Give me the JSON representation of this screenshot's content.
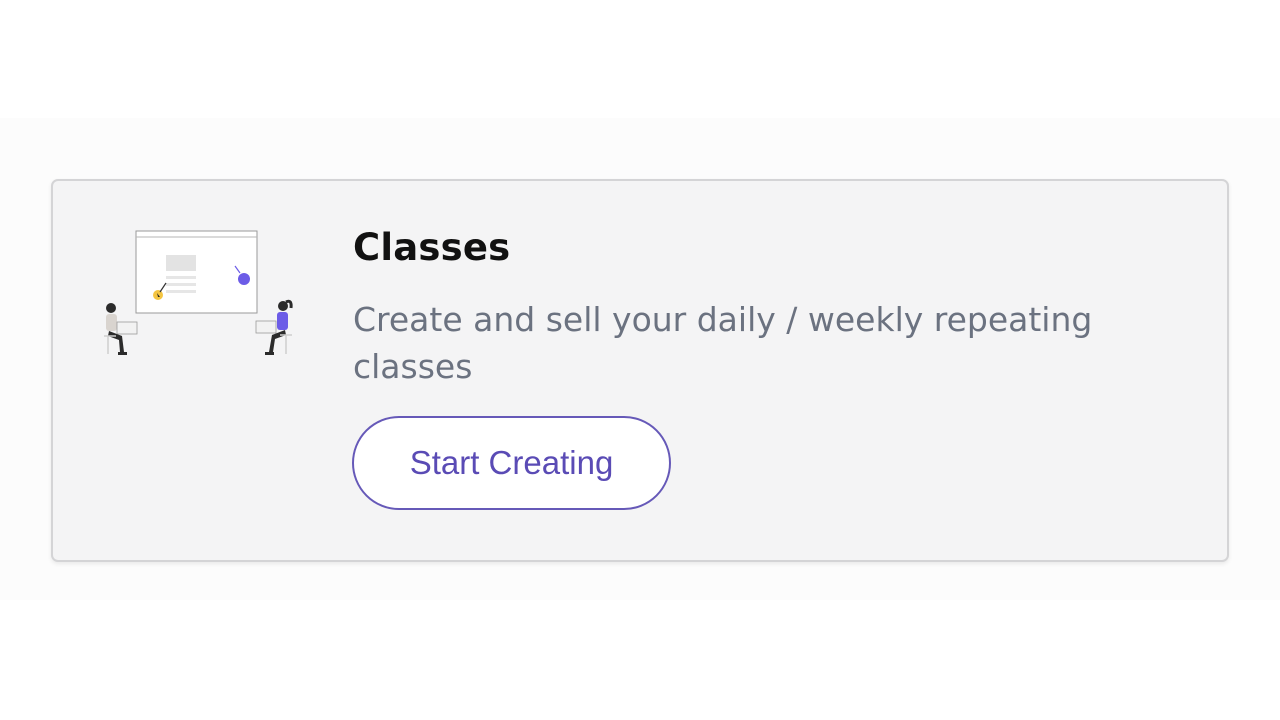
{
  "card": {
    "illustration_icon": "people-at-whiteboard-illustration",
    "title": "Classes",
    "description": "Create and sell your daily / weekly repeating classes",
    "cta_label": "Start Creating"
  },
  "colors": {
    "accent": "#5a4bb5",
    "accent_dot": "#6c5ce7",
    "highlight": "#f4c542",
    "card_background": "#f4f4f5",
    "description_text": "#6b7280"
  }
}
